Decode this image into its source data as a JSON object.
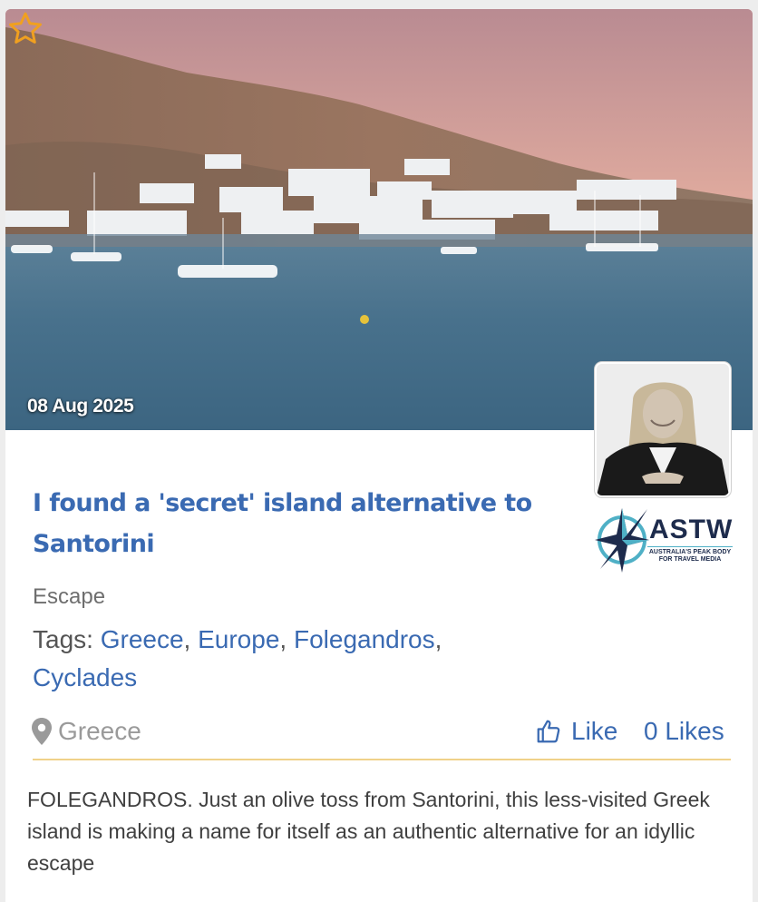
{
  "article": {
    "date": "08 Aug 2025",
    "title": "I found a 'secret' island alternative to Santorini",
    "category": "Escape",
    "tags_label": "Tags:",
    "tags": [
      "Greece",
      "Europe",
      "Folegandros",
      "Cyclades"
    ],
    "location": "Greece",
    "like_label": "Like",
    "likes_count": "0 Likes",
    "summary": "FOLEGANDROS. Just an olive toss from Santorini, this less-visited Greek island is making a name for itself as an authentic alternative for an idyllic escape"
  },
  "logo": {
    "name": "ASTW",
    "tagline": "AUSTRALIA'S PEAK BODY FOR TRAVEL MEDIA"
  },
  "icons": {
    "favorite": "star-outline-icon",
    "location": "map-pin-icon",
    "like": "thumbs-up-icon"
  },
  "colors": {
    "title": "#3a6ab2",
    "link": "#3a6ab2",
    "star": "#f0a020",
    "divider": "#f0d28a",
    "muted": "#9a9a9a"
  }
}
